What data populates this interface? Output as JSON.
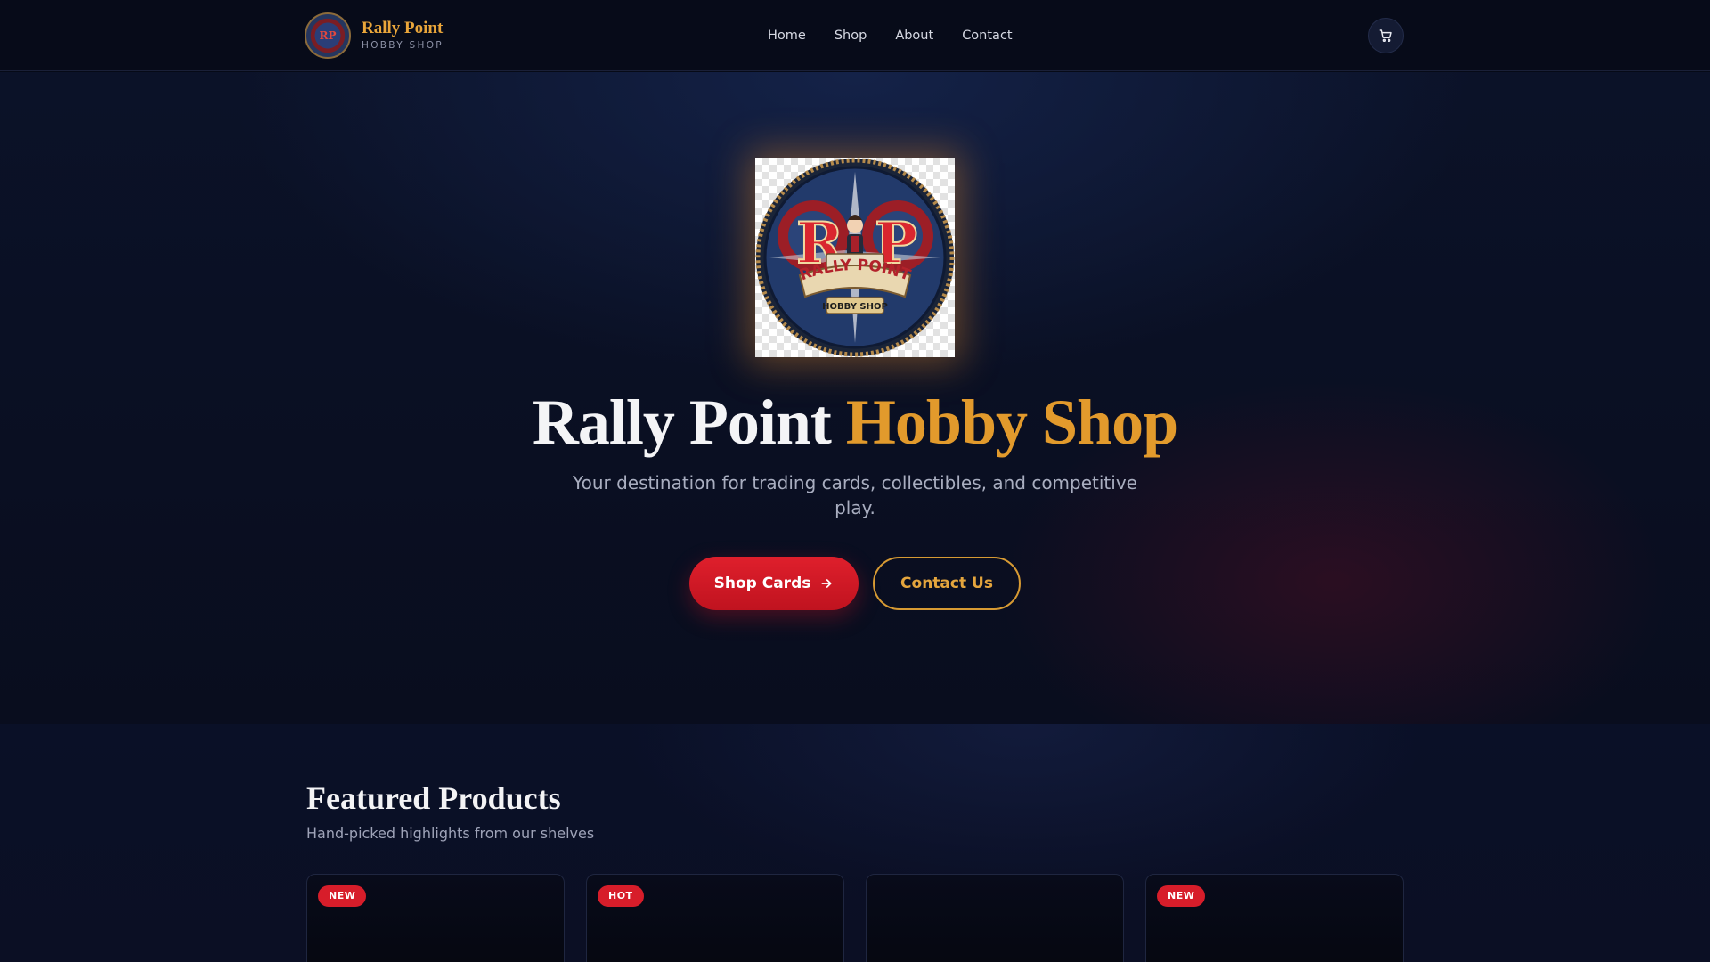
{
  "brand": {
    "name": "Rally Point",
    "tagline": "HOBBY SHOP",
    "logo_initials": "RP"
  },
  "nav": {
    "links": [
      "Home",
      "Shop",
      "About",
      "Contact"
    ],
    "cart_icon": "cart-icon"
  },
  "hero": {
    "logo": {
      "top_text": "RALLY POINT",
      "bottom_text": "HOBBY SHOP",
      "letters": [
        "R",
        "P"
      ]
    },
    "title_main": "Rally Point",
    "title_accent": "Hobby Shop",
    "subtitle": "Your destination for trading cards, collectibles, and competitive play.",
    "primary_button": "Shop Cards",
    "primary_icon": "arrow-right-icon",
    "secondary_button": "Contact Us"
  },
  "featured": {
    "title": "Featured Products",
    "subtitle": "Hand-picked highlights from our shelves",
    "badges": [
      "NEW",
      "HOT",
      "",
      "NEW"
    ]
  },
  "colors": {
    "accent_gold": "#e29a2c",
    "primary_red": "#d71d2a",
    "background": "#060a17"
  }
}
